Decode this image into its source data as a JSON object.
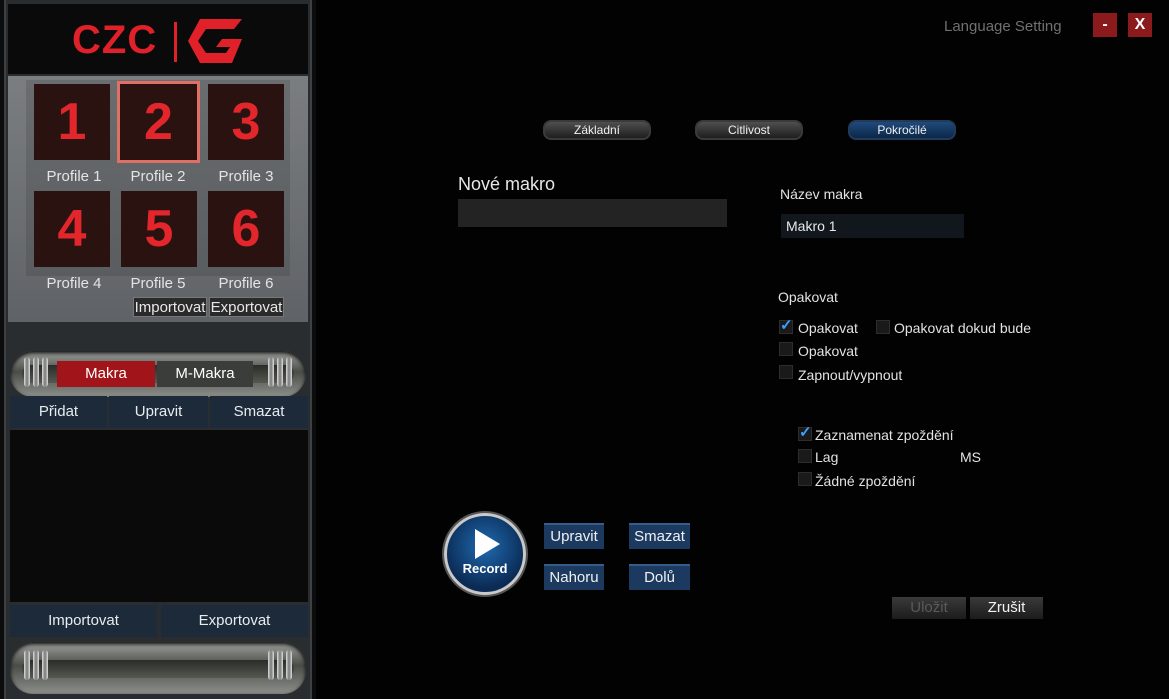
{
  "logo": {
    "text": "CZC"
  },
  "profiles": [
    {
      "number": "1",
      "label": "Profile 1"
    },
    {
      "number": "2",
      "label": "Profile 2"
    },
    {
      "number": "3",
      "label": "Profile 3"
    },
    {
      "number": "4",
      "label": "Profile 4"
    },
    {
      "number": "5",
      "label": "Profile 5"
    },
    {
      "number": "6",
      "label": "Profile 6"
    }
  ],
  "active_profile": "Profile 2",
  "profile_actions": {
    "import": "Importovat",
    "export": "Exportovat"
  },
  "macro_tabs": {
    "makra": "Makra",
    "m_makra": "M-Makra"
  },
  "macro_actions": {
    "add": "Přidat",
    "edit": "Upravit",
    "delete": "Smazat"
  },
  "macro_list_actions": {
    "import": "Importovat",
    "export": "Exportovat"
  },
  "header": {
    "language_setting": "Language Setting",
    "minimize": "-",
    "close": "X"
  },
  "main_tabs": [
    {
      "label": "Základní",
      "active": false
    },
    {
      "label": "Citlivost",
      "active": false
    },
    {
      "label": "Pokročilé",
      "active": true
    }
  ],
  "editor": {
    "title": "Nové makro",
    "name_label": "Název makra",
    "name_value": "Makro 1",
    "repeat_label": "Opakovat",
    "repeat_options": [
      {
        "label": "Opakovat",
        "checked": true
      },
      {
        "label": "Opakovat dokud bude",
        "checked": false
      },
      {
        "label": "Opakovat",
        "checked": false
      },
      {
        "label": "Zapnout/vypnout",
        "checked": false
      }
    ],
    "delay_options": [
      {
        "label": "Zaznamenat zpoždění",
        "checked": true
      },
      {
        "label": "Lag",
        "checked": false
      },
      {
        "label": "Žádné zpoždění",
        "checked": false
      }
    ],
    "delay_unit": "MS",
    "record_label": "Record",
    "edit_label": "Upravit",
    "delete_label": "Smazat",
    "up_label": "Nahoru",
    "down_label": "Dolů",
    "save_label": "Uložit",
    "cancel_label": "Zrušit"
  },
  "colors": {
    "brand_red": "#e0212a",
    "accent_blue": "#1c3a60",
    "check_blue": "#38a2ff"
  }
}
